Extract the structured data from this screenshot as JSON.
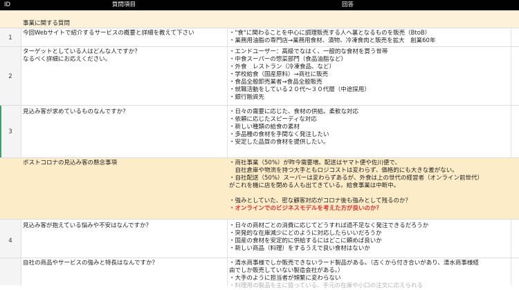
{
  "header": {
    "id": "ID",
    "question": "質問項目",
    "answer": "回答"
  },
  "section_label": "事業に関する質問",
  "rows": [
    {
      "id": "1",
      "question": [
        "今回Webサイトで紹介するサービスの概要と詳細を教えて下さい"
      ],
      "answer": [
        "・\"食\"に関わることを中心に調理販売する人へ裏となるものを販売（BtoB）",
        "・業務用油脂の専門店→業務用食材、漬物、冷凍食肉と販売を拡大　創業60年"
      ]
    },
    {
      "id": "2",
      "question": [
        "ターゲットとしている人はどんな人ですか？",
        "なるべく詳細にお応えください。"
      ],
      "answer": [
        "・エンドユーザー：高級でなはく、一般的な食材を買う世帯",
        "・中食スーパーの惣菜部門（食品油脂など）",
        "・外食　レストラン（冷凍食品、など）",
        "・学校給食（国産原料）→商社に販売",
        "・食品全般卸売業者→食品全般販売",
        "・就職活動をしている２０代〜３０代層（中途採用）",
        "・銀行融資先"
      ]
    },
    {
      "id": "3",
      "question": [
        "見込み客が求めているものなんですか？"
      ],
      "answer": [
        "・日々の需要に応じた、食材の供給。柔軟な対応",
        "・依頼に応じたスピーディな対応",
        "・新しい種類の給食の素材",
        "・多品種の食材を手間なく発注したい",
        "・安定した品質の食材を提供したい。"
      ]
    },
    {
      "id": "",
      "question": [
        "ポストコロナの見込み客の懸念事項"
      ],
      "answer": [
        "・商社事業（50%）が昨今需要増。配送はヤマト便や佐川便で、",
        "　自社倉庫や物流を持つ大手ともロジコストは変わらず、価格的にも大きな差がない。",
        "・自社配送（50%）スーパーは変わらずあるが、外食は上の世代の経営者（オンライン前世代）",
        "がこれを機に店を閉める人も出てきている。給食事業は中断中。",
        "",
        "・強みとしていた、密な顧客対応がコロナ後も強みとして残るのか？",
        "・オンラインでのビジネスモデルを考えた方が良いのか？"
      ]
    },
    {
      "id": "4",
      "question": [
        "見込み客が抱えている悩みや不安はなんですか？"
      ],
      "answer": [
        "・日々の商材ごとの消費に応じてどうすれば過不足なく発注できるだろうか",
        "・突発的な在庫減少にどのように対応したらいいだろうか",
        "・国産の食材を安定的に供給するにはどこに頼めば良いか",
        "・新しい商品（料理）をするうえで良い食材はないか"
      ]
    },
    {
      "id": "",
      "question": [
        "自社の商品やサービスの強みと特長はなんですか？"
      ],
      "answer": [
        "・清水商事様でしか販売できないラード製品がある。（古くから付き合いがあり、清水商事様経",
        "由でしか販売していない製造会社がある。）",
        "・大手のように担当者が頻繁に変わらない",
        "・料理用の製品を主に扱っている、手元の在庫や小口の注文に応えられる"
      ]
    }
  ]
}
